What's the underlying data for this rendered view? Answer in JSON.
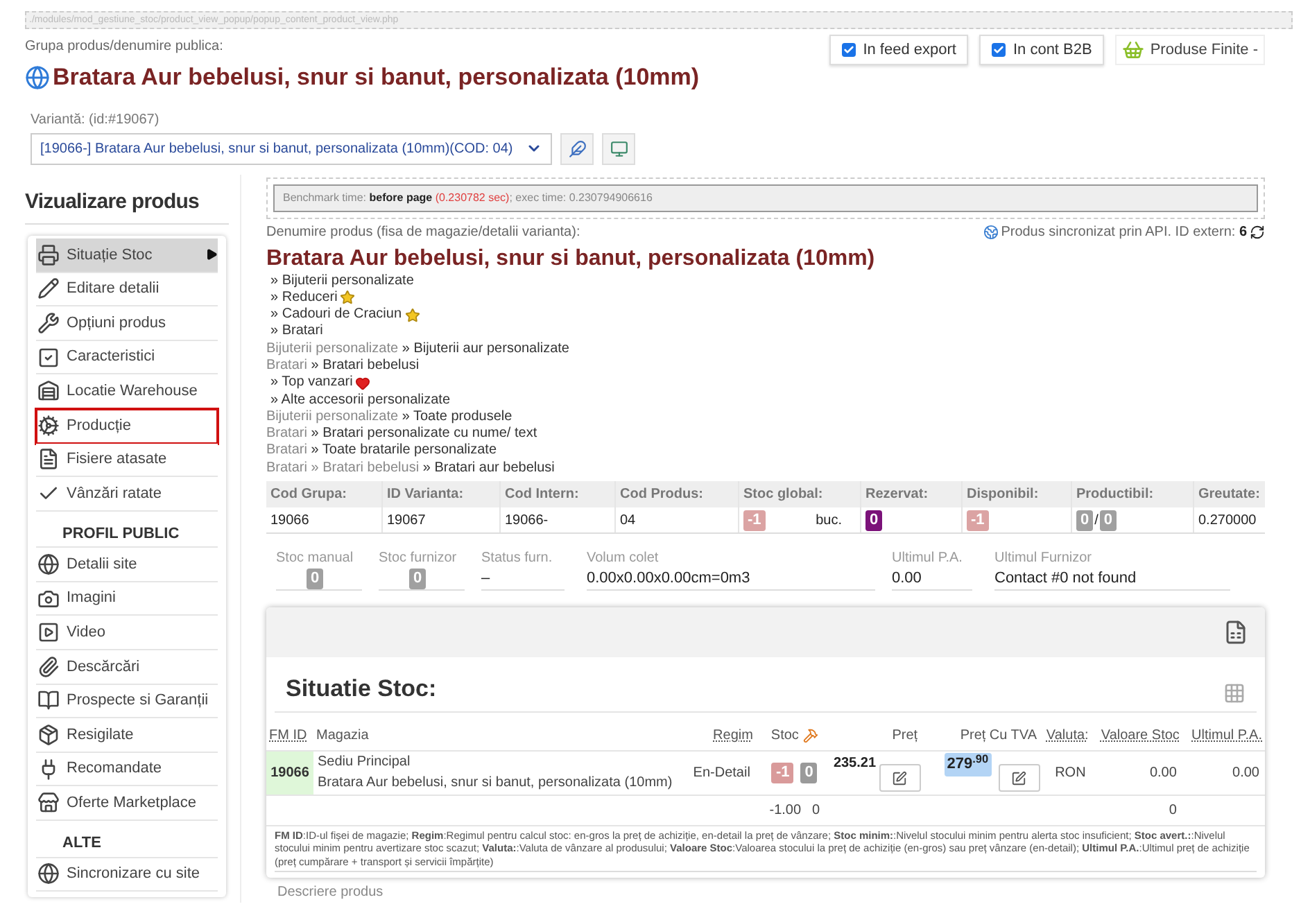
{
  "path_bar": "./modules/mod_gestiune_stoc/product_view_popup/popup_content_product_view.php",
  "header": {
    "group_label": "Grupa produs/denumire publica:",
    "title": "Bratara Aur bebelusi, snur si banut, personalizata (10mm)",
    "toggles": [
      {
        "label": "In feed export",
        "checked": true
      },
      {
        "label": "In cont B2B",
        "checked": true
      }
    ],
    "category_button": "Produse Finite -"
  },
  "variant": {
    "label": "Variantă: (id:#19067)",
    "value": "[19066-] Bratara Aur bebelusi, snur si banut, personalizata (10mm)(COD: 04)"
  },
  "sidebar": {
    "title": "Vizualizare produs",
    "sections": [
      {
        "items": [
          {
            "label": "Situație Stoc",
            "selected": true,
            "outlined": false
          },
          {
            "label": "Editare detalii",
            "selected": false,
            "outlined": false
          },
          {
            "label": "Opțiuni produs",
            "selected": false,
            "outlined": false
          },
          {
            "label": "Caracteristici",
            "selected": false,
            "outlined": false
          },
          {
            "label": "Locatie Warehouse",
            "selected": false,
            "outlined": false
          },
          {
            "label": "Producție",
            "selected": false,
            "outlined": true
          },
          {
            "label": "Fisiere atasate",
            "selected": false,
            "outlined": false
          },
          {
            "label": "Vânzări ratate",
            "selected": false,
            "outlined": false
          }
        ]
      },
      {
        "title": "PROFIL PUBLIC",
        "items": [
          {
            "label": "Detalii site",
            "selected": false,
            "outlined": false
          },
          {
            "label": "Imagini",
            "selected": false,
            "outlined": false
          },
          {
            "label": "Video",
            "selected": false,
            "outlined": false
          },
          {
            "label": "Descărcări",
            "selected": false,
            "outlined": false
          },
          {
            "label": "Prospecte si Garanții",
            "selected": false,
            "outlined": false
          },
          {
            "label": "Resigilate",
            "selected": false,
            "outlined": false
          },
          {
            "label": "Recomandate",
            "selected": false,
            "outlined": false
          },
          {
            "label": "Oferte Marketplace",
            "selected": false,
            "outlined": false
          }
        ]
      },
      {
        "title": "ALTE",
        "items": [
          {
            "label": "Sincronizare cu site",
            "selected": false,
            "outlined": false
          }
        ]
      }
    ]
  },
  "benchmark": {
    "label": "Benchmark time:",
    "phase": "before page",
    "time": "(0.230782 sec)",
    "rest": "; exec time: 0.230794906616"
  },
  "product": {
    "label": "Denumire produs (fisa de magazie/detalii varianta):",
    "sync_text": "Produs sincronizat prin API. ID extern:",
    "sync_id": "6",
    "title": "Bratara Aur bebelusi, snur si banut, personalizata (10mm)",
    "separator": "»",
    "categories": [
      {
        "kind": "plain",
        "trail": [
          "Bijuterii personalizate"
        ]
      },
      {
        "kind": "star",
        "trail": [
          "Reduceri"
        ]
      },
      {
        "kind": "star",
        "trail": [
          "Cadouri de Craciun"
        ]
      },
      {
        "kind": "plain",
        "trail": [
          "Bratari"
        ]
      },
      {
        "kind": "plain",
        "trail": [
          "Bijuterii personalizate",
          "Bijuterii aur personalizate"
        ]
      },
      {
        "kind": "plain",
        "trail": [
          "Bratari",
          "Bratari bebelusi"
        ]
      },
      {
        "kind": "heart",
        "trail": [
          "Top vanzari"
        ]
      },
      {
        "kind": "plain",
        "trail": [
          "Alte accesorii personalizate"
        ]
      },
      {
        "kind": "plain",
        "trail": [
          "Bijuterii personalizate",
          "Toate produsele"
        ]
      },
      {
        "kind": "plain",
        "trail": [
          "Bratari",
          "Bratari personalizate cu nume/ text"
        ]
      },
      {
        "kind": "plain",
        "trail": [
          "Bratari",
          "Toate bratarile personalizate"
        ]
      },
      {
        "kind": "plain",
        "trail": [
          "Bratari",
          "Bratari bebelusi",
          "Bratari aur bebelusi"
        ]
      }
    ]
  },
  "info_table": [
    {
      "label": "Cod Grupa:",
      "parts": [
        {
          "kind": "text",
          "text": "19066"
        }
      ]
    },
    {
      "label": "ID Varianta:",
      "parts": [
        {
          "kind": "text",
          "text": "19067"
        }
      ]
    },
    {
      "label": "Cod Intern:",
      "parts": [
        {
          "kind": "text",
          "text": "19066-"
        }
      ]
    },
    {
      "label": "Cod Produs:",
      "parts": [
        {
          "kind": "text",
          "text": "04"
        }
      ]
    },
    {
      "label": "Stoc global:",
      "parts": [
        {
          "kind": "badge",
          "text": "-1",
          "color": "#dba3a3"
        },
        {
          "kind": "unit",
          "text": "buc."
        }
      ]
    },
    {
      "label": "Rezervat:",
      "parts": [
        {
          "kind": "badge",
          "text": "0",
          "color": "#7b1279"
        }
      ]
    },
    {
      "label": "Disponibil:",
      "parts": [
        {
          "kind": "badge",
          "text": "-1",
          "color": "#dba3a3"
        }
      ]
    },
    {
      "label": "Productibil:",
      "parts": [
        {
          "kind": "badge",
          "text": "0",
          "color": "#a0a0a0"
        },
        {
          "kind": "text",
          "text": "/"
        },
        {
          "kind": "badge",
          "text": "0",
          "color": "#a0a0a0"
        }
      ]
    },
    {
      "label": "Greutate:",
      "parts": [
        {
          "kind": "text",
          "text": "0.270000"
        }
      ]
    }
  ],
  "fields": [
    {
      "label": "Stoc manual",
      "kind": "badge",
      "value": "0"
    },
    {
      "label": "Stoc furnizor",
      "kind": "badge",
      "value": "0"
    },
    {
      "label": "Status furn.",
      "kind": "text",
      "value": "–"
    },
    {
      "label": "Volum colet",
      "kind": "text",
      "value": "0.00x0.00x0.00cm=0m3"
    },
    {
      "label": "Ultimul P.A.",
      "kind": "text",
      "value": "0.00"
    },
    {
      "label": "Ultimul Furnizor",
      "kind": "text",
      "value": "Contact #0 not found"
    }
  ],
  "stock": {
    "title": "Situatie Stoc:",
    "columns": [
      {
        "label": "FM ID",
        "hint": true
      },
      {
        "label": "Magazia",
        "hint": false
      },
      {
        "label": "Regim",
        "hint": true
      },
      {
        "label": "Stoc",
        "hint": false
      },
      {
        "label": "Preț",
        "hint": false
      },
      {
        "label": "Preț Cu TVA",
        "hint": false
      },
      {
        "label": "Valuta:",
        "hint": true
      },
      {
        "label": "Valoare Stoc",
        "hint": true
      },
      {
        "label": "Ultimul P.A.",
        "hint": true
      }
    ],
    "rows": [
      {
        "fm_id": "19066",
        "warehouse": "Sediu Principal",
        "product": "Bratara Aur bebelusi, snur si banut, personalizata (10mm)",
        "regim": "En-Detail",
        "stoc": [
          {
            "text": "-1",
            "color": "#d99a9a"
          },
          {
            "text": "0",
            "color": "#9a9a9a"
          }
        ],
        "price": "235.21",
        "price_vat": "279$^{.90}$",
        "currency": "RON",
        "stock_value": "0.00",
        "last_pa": "0.00"
      }
    ],
    "totals": {
      "stoc": "-1.00",
      "stoc_2": "0",
      "stock_value": "0"
    },
    "legend": "**FM ID**:ID-ul fișei de magazie; **Regim**:Regimul pentru calcul stoc: en-gros la preț de achiziție, en-detail la preț de vânzare; **Stoc minim:**:Nivelul stocului minim pentru alerta stoc insuficient; **Stoc avert.:**:Nivelul stocului minim pentru avertizare stoc scazut; **Valuta:**:Valuta de vânzare al produsului; **Valoare Stoc**:Valoarea stocului la preț de achiziție (en-gros) sau preț vânzare (en-detail); **Ultimul P.A.**:Ultimul preț de achiziție (preț cumpărare + transport și servicii împărțite)"
  },
  "description_label": "Descriere produs"
}
